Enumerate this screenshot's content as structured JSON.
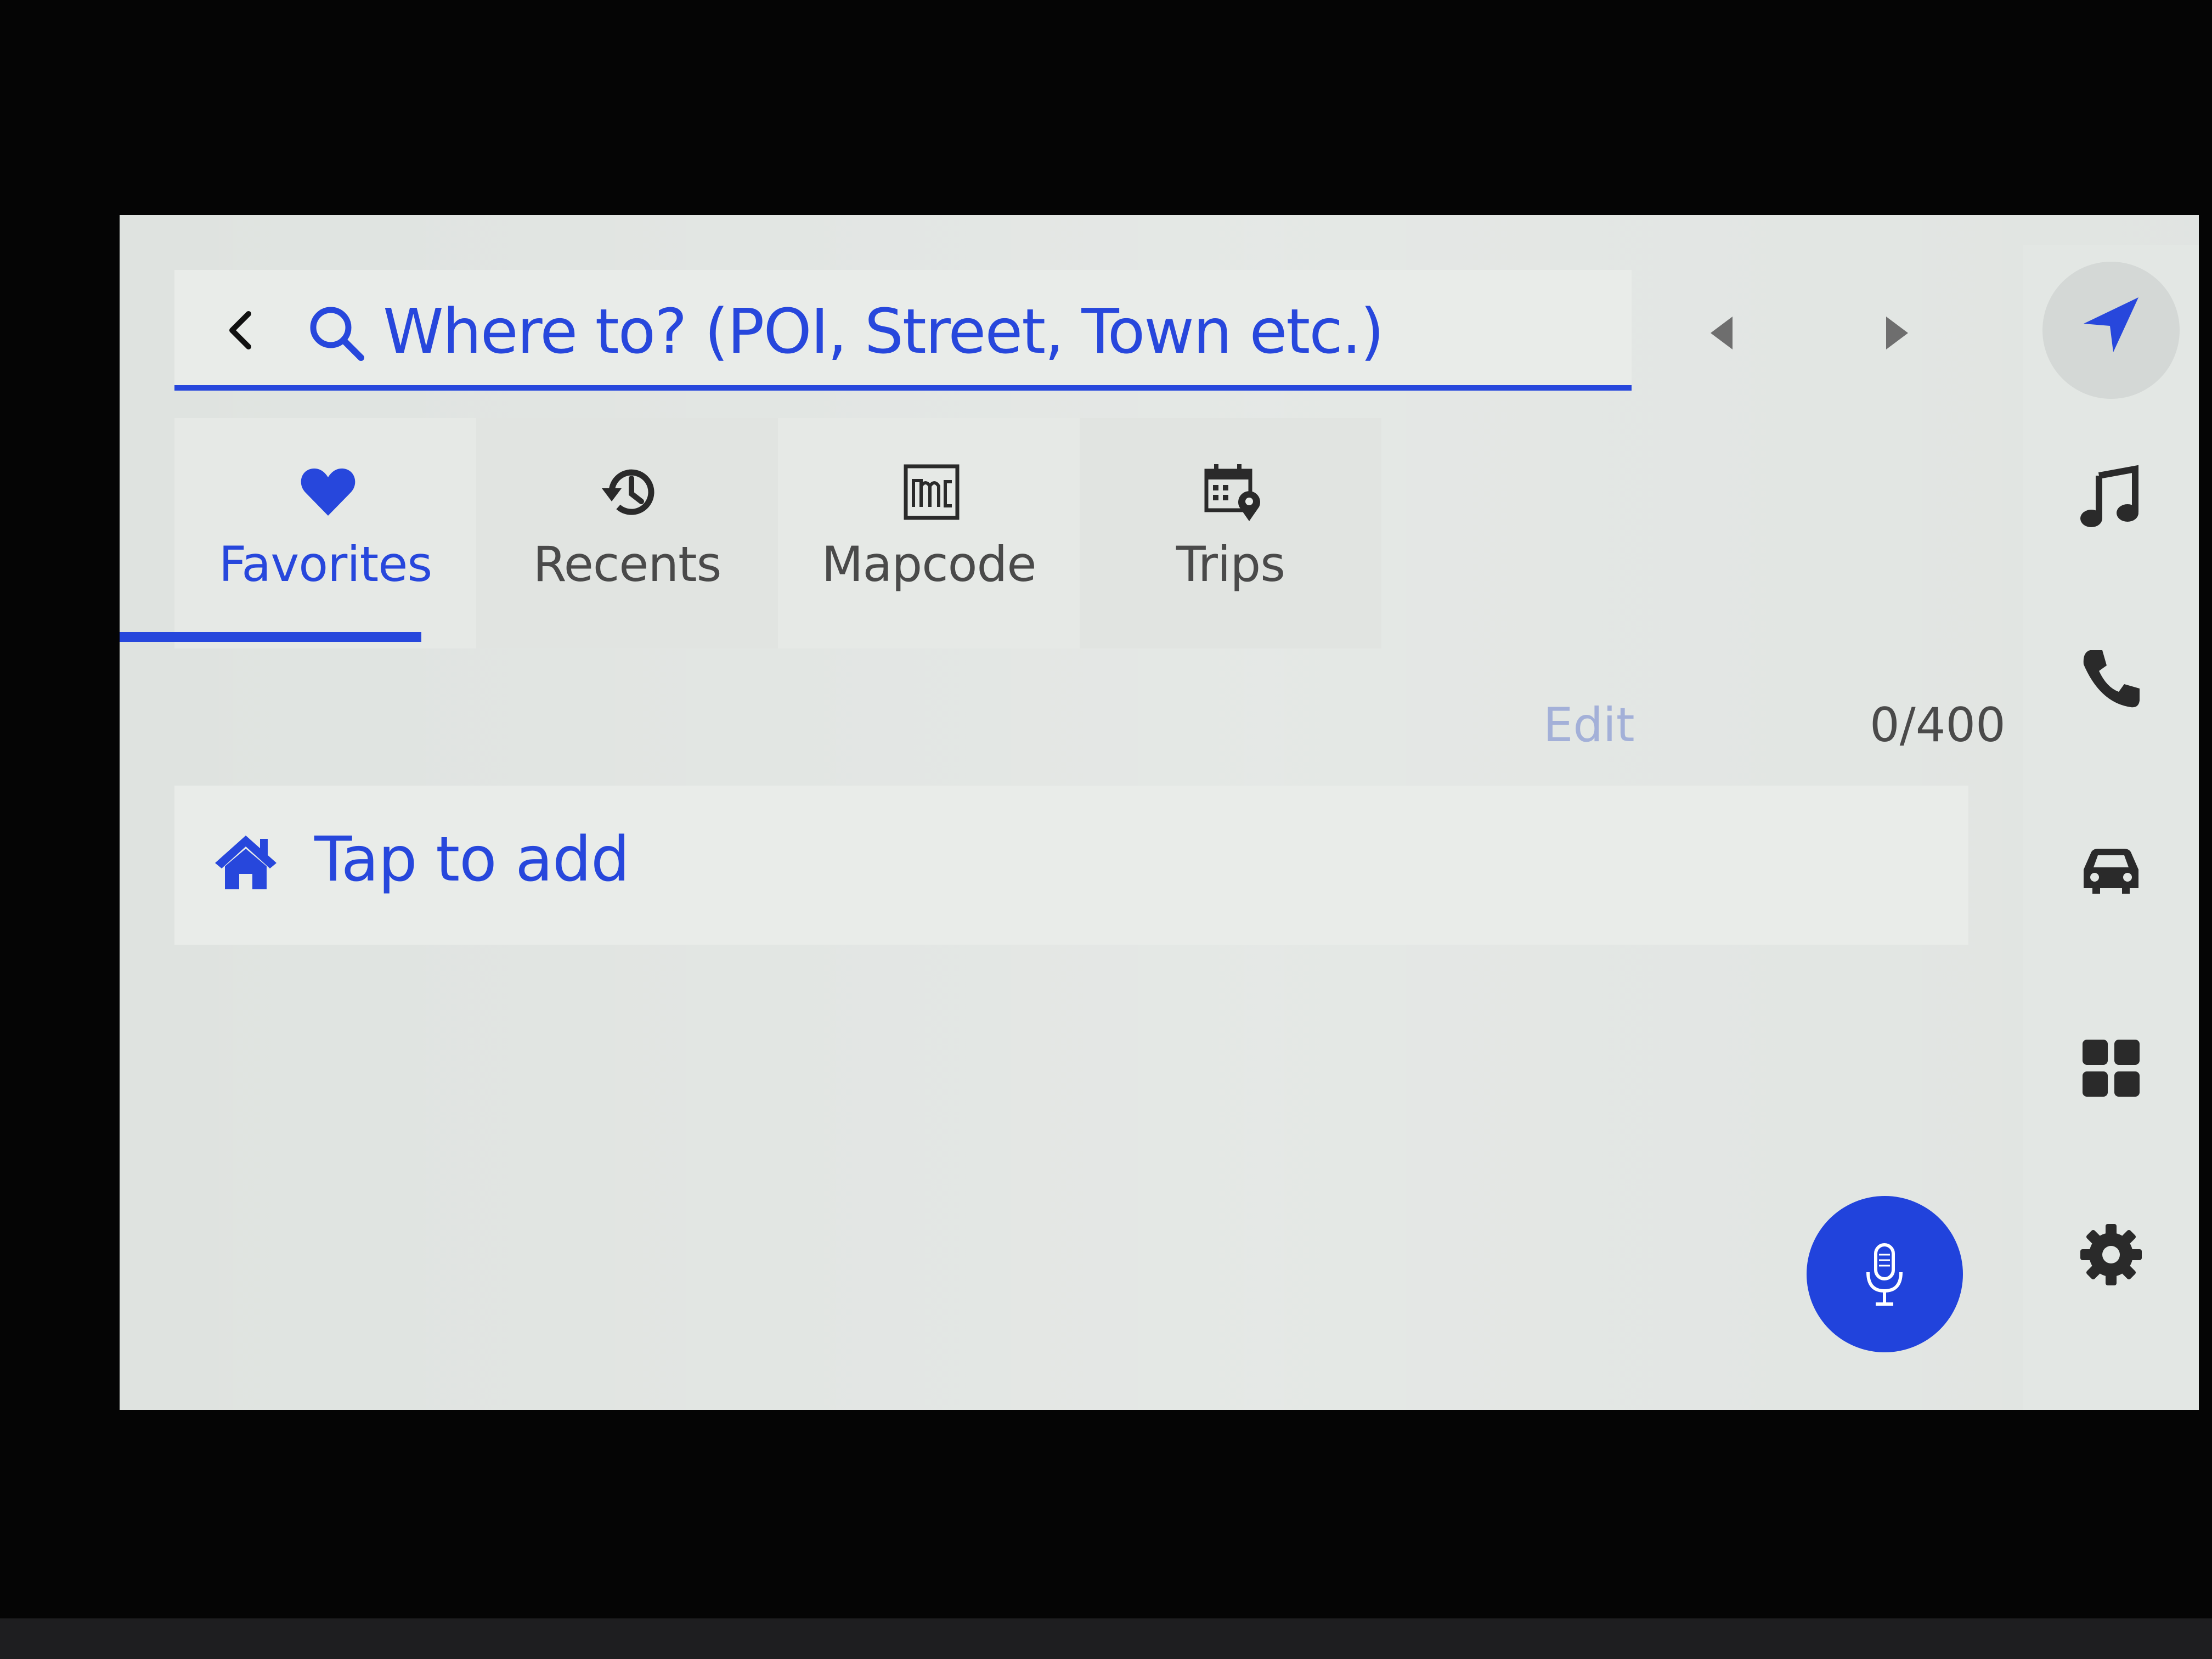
{
  "search": {
    "placeholder": "Where to? (POI, Street, Town etc.)"
  },
  "tabs": [
    {
      "label": "Favorites",
      "icon": "heart-icon",
      "active": true
    },
    {
      "label": "Recents",
      "icon": "history-icon",
      "active": false
    },
    {
      "label": "Mapcode",
      "icon": "mapcode-icon",
      "active": false
    },
    {
      "label": "Trips",
      "icon": "trips-calendar-icon",
      "active": false
    }
  ],
  "favorites": {
    "edit_label": "Edit",
    "count": "0/400",
    "home_row_label": "Tap to add"
  },
  "rail": [
    {
      "name": "navigation",
      "icon": "navigation-arrow-icon",
      "active": true
    },
    {
      "name": "music",
      "icon": "music-note-icon"
    },
    {
      "name": "phone",
      "icon": "phone-icon"
    },
    {
      "name": "vehicle",
      "icon": "car-icon"
    },
    {
      "name": "apps",
      "icon": "apps-grid-icon"
    },
    {
      "name": "settings",
      "icon": "gear-icon"
    }
  ],
  "colors": {
    "accent": "#2747dc",
    "screen_bg": "#dfe3e0",
    "muted_text": "#4a4a4a",
    "disabled_text": "#a3b0d8"
  }
}
